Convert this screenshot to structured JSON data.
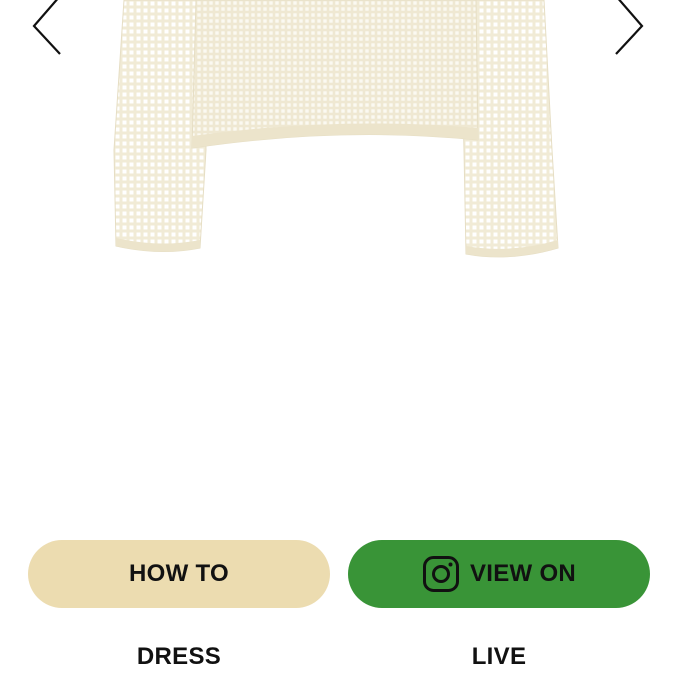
{
  "carousel": {
    "prev_icon": "chevron-left-icon",
    "next_icon": "chevron-right-icon",
    "image": {
      "subject": "cream crochet mesh knit sweater",
      "color": "#f4efde"
    }
  },
  "actions": {
    "how_to": {
      "label": "HOW TO",
      "sublabel": "DRESS",
      "bg": "#ecdcb0"
    },
    "view_on": {
      "label": "VIEW ON",
      "sublabel": "LIVE",
      "icon": "instagram-icon",
      "bg": "#399437"
    }
  }
}
